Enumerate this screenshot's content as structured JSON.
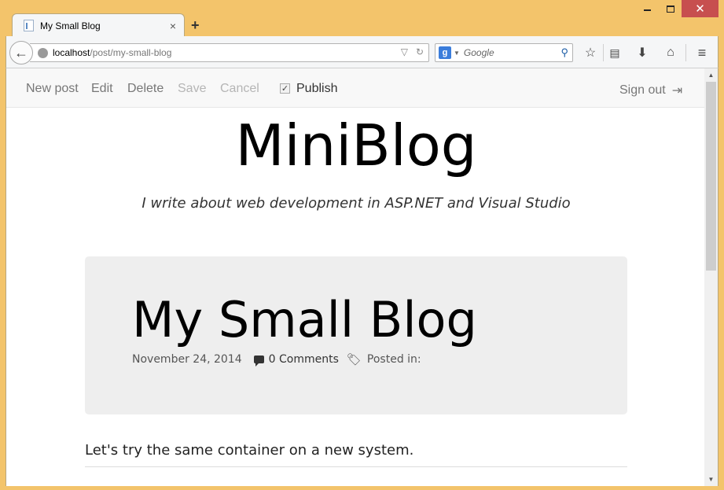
{
  "browser": {
    "tab_title": "My Small Blog",
    "tab_close": "×",
    "new_tab": "+",
    "url_host": "localhost",
    "url_path": "/post/my-small-blog",
    "search_placeholder": "Google",
    "search_engine_letter": "g"
  },
  "admin_bar": {
    "new_post": "New post",
    "edit": "Edit",
    "delete": "Delete",
    "save": "Save",
    "cancel": "Cancel",
    "publish": "Publish",
    "publish_checked": true,
    "sign_out": "Sign out"
  },
  "site": {
    "title": "MiniBlog",
    "subtitle": "I write about web development in ASP.NET and Visual Studio"
  },
  "post": {
    "title": "My Small Blog",
    "date": "November 24, 2014",
    "comments": "0 Comments",
    "posted_in": "Posted in:",
    "body": "Let's try the same container on a new system."
  },
  "icons": {
    "back": "back-arrow-icon",
    "globe": "globe-icon",
    "reload": "reload-icon",
    "bookmark": "star-icon",
    "reading_list": "reading-list-icon",
    "download": "download-icon",
    "home": "home-icon",
    "menu": "hamburger-menu-icon",
    "comment": "comment-icon",
    "tags": "tags-icon",
    "sign_out": "sign-out-icon"
  },
  "colors": {
    "window_frame": "#f3c46b",
    "close_button": "#c74f4f",
    "post_header_bg": "#eeeeee"
  }
}
